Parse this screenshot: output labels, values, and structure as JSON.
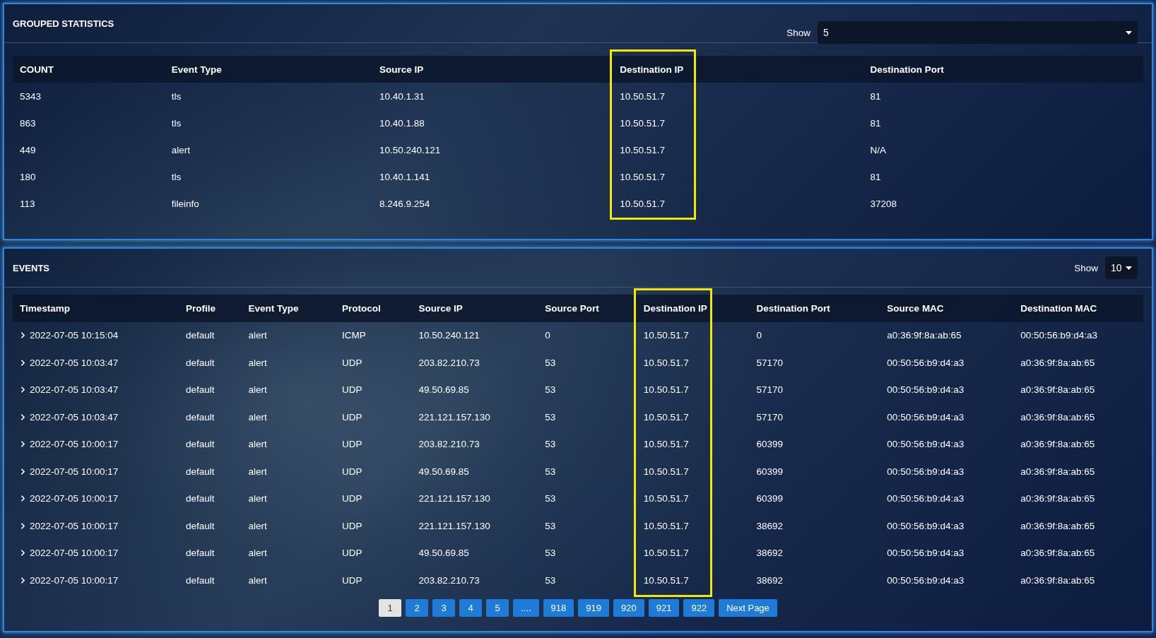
{
  "grouped_statistics": {
    "title": "GROUPED STATISTICS",
    "show_label": "Show",
    "show_value": "5",
    "columns": [
      {
        "label": "COUNT",
        "highlighted": false
      },
      {
        "label": "Event Type",
        "highlighted": false
      },
      {
        "label": "Source IP",
        "highlighted": false
      },
      {
        "label": "Destination IP",
        "highlighted": true
      },
      {
        "label": "Destination Port",
        "highlighted": false
      }
    ],
    "rows": [
      [
        "5343",
        "tls",
        "10.40.1.31",
        "10.50.51.7",
        "81"
      ],
      [
        "863",
        "tls",
        "10.40.1.88",
        "10.50.51.7",
        "81"
      ],
      [
        "449",
        "alert",
        "10.50.240.121",
        "10.50.51.7",
        "N/A"
      ],
      [
        "180",
        "tls",
        "10.40.1.141",
        "10.50.51.7",
        "81"
      ],
      [
        "113",
        "fileinfo",
        "8.246.9.254",
        "10.50.51.7",
        "37208"
      ]
    ]
  },
  "events": {
    "title": "EVENTS",
    "show_label": "Show",
    "show_value": "10",
    "columns": [
      {
        "label": "Timestamp",
        "highlighted": false
      },
      {
        "label": "Profile",
        "highlighted": false
      },
      {
        "label": "Event Type",
        "highlighted": false
      },
      {
        "label": "Protocol",
        "highlighted": false
      },
      {
        "label": "Source IP",
        "highlighted": false
      },
      {
        "label": "Source Port",
        "highlighted": false
      },
      {
        "label": "Destination IP",
        "highlighted": true
      },
      {
        "label": "Destination Port",
        "highlighted": false
      },
      {
        "label": "Source MAC",
        "highlighted": false
      },
      {
        "label": "Destination MAC",
        "highlighted": false
      }
    ],
    "rows": [
      {
        "expanded": false,
        "cells": [
          "2022-07-05 10:15:04",
          "default",
          "alert",
          "ICMP",
          "10.50.240.121",
          "0",
          "10.50.51.7",
          "0",
          "a0:36:9f:8a:ab:65",
          "00:50:56:b9:d4:a3"
        ]
      },
      {
        "expanded": false,
        "cells": [
          "2022-07-05 10:03:47",
          "default",
          "alert",
          "UDP",
          "203.82.210.73",
          "53",
          "10.50.51.7",
          "57170",
          "00:50:56:b9:d4:a3",
          "a0:36:9f:8a:ab:65"
        ]
      },
      {
        "expanded": false,
        "cells": [
          "2022-07-05 10:03:47",
          "default",
          "alert",
          "UDP",
          "49.50.69.85",
          "53",
          "10.50.51.7",
          "57170",
          "00:50:56:b9:d4:a3",
          "a0:36:9f:8a:ab:65"
        ]
      },
      {
        "expanded": false,
        "cells": [
          "2022-07-05 10:03:47",
          "default",
          "alert",
          "UDP",
          "221.121.157.130",
          "53",
          "10.50.51.7",
          "57170",
          "00:50:56:b9:d4:a3",
          "a0:36:9f:8a:ab:65"
        ]
      },
      {
        "expanded": false,
        "cells": [
          "2022-07-05 10:00:17",
          "default",
          "alert",
          "UDP",
          "203.82.210.73",
          "53",
          "10.50.51.7",
          "60399",
          "00:50:56:b9:d4:a3",
          "a0:36:9f:8a:ab:65"
        ]
      },
      {
        "expanded": false,
        "cells": [
          "2022-07-05 10:00:17",
          "default",
          "alert",
          "UDP",
          "49.50.69.85",
          "53",
          "10.50.51.7",
          "60399",
          "00:50:56:b9:d4:a3",
          "a0:36:9f:8a:ab:65"
        ]
      },
      {
        "expanded": false,
        "cells": [
          "2022-07-05 10:00:17",
          "default",
          "alert",
          "UDP",
          "221.121.157.130",
          "53",
          "10.50.51.7",
          "60399",
          "00:50:56:b9:d4:a3",
          "a0:36:9f:8a:ab:65"
        ]
      },
      {
        "expanded": false,
        "cells": [
          "2022-07-05 10:00:17",
          "default",
          "alert",
          "UDP",
          "221.121.157.130",
          "53",
          "10.50.51.7",
          "38692",
          "00:50:56:b9:d4:a3",
          "a0:36:9f:8a:ab:65"
        ]
      },
      {
        "expanded": false,
        "cells": [
          "2022-07-05 10:00:17",
          "default",
          "alert",
          "UDP",
          "49.50.69.85",
          "53",
          "10.50.51.7",
          "38692",
          "00:50:56:b9:d4:a3",
          "a0:36:9f:8a:ab:65"
        ]
      },
      {
        "expanded": false,
        "cells": [
          "2022-07-05 10:00:17",
          "default",
          "alert",
          "UDP",
          "203.82.210.73",
          "53",
          "10.50.51.7",
          "38692",
          "00:50:56:b9:d4:a3",
          "a0:36:9f:8a:ab:65"
        ]
      }
    ],
    "pagination": [
      {
        "label": "1",
        "selected": true
      },
      {
        "label": "2",
        "selected": false
      },
      {
        "label": "3",
        "selected": false
      },
      {
        "label": "4",
        "selected": false
      },
      {
        "label": "5",
        "selected": false
      },
      {
        "label": "....",
        "selected": false
      },
      {
        "label": "918",
        "selected": false
      },
      {
        "label": "919",
        "selected": false
      },
      {
        "label": "920",
        "selected": false
      },
      {
        "label": "921",
        "selected": false
      },
      {
        "label": "922",
        "selected": false
      },
      {
        "label": "Next Page",
        "selected": false
      }
    ]
  }
}
